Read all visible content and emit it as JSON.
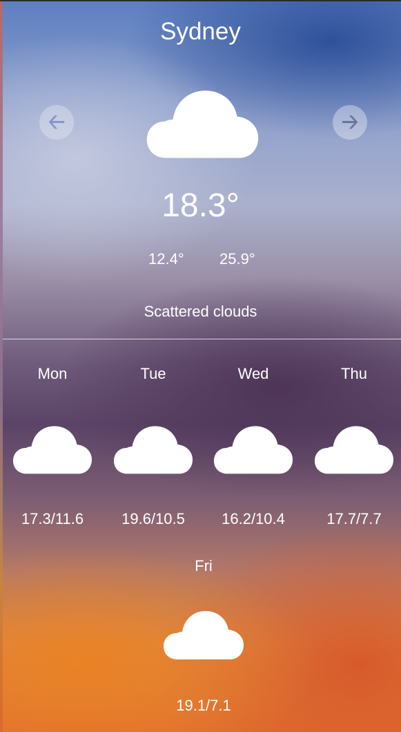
{
  "current": {
    "city": "Sydney",
    "temperature": "18.3°",
    "min": "12.4°",
    "max": "25.9°",
    "description": "Scattered clouds",
    "icon": "cloud-icon"
  },
  "nav": {
    "prev_icon": "arrow-left-icon",
    "next_icon": "arrow-right-icon"
  },
  "forecast": [
    {
      "day": "Mon",
      "range": "17.3/11.6",
      "icon": "cloud-icon"
    },
    {
      "day": "Tue",
      "range": "19.6/10.5",
      "icon": "cloud-icon"
    },
    {
      "day": "Wed",
      "range": "16.2/10.4",
      "icon": "cloud-icon"
    },
    {
      "day": "Thu",
      "range": "17.7/7.7",
      "icon": "cloud-icon"
    },
    {
      "day": "Fri",
      "range": "19.1/7.1",
      "icon": "cloud-icon"
    }
  ]
}
